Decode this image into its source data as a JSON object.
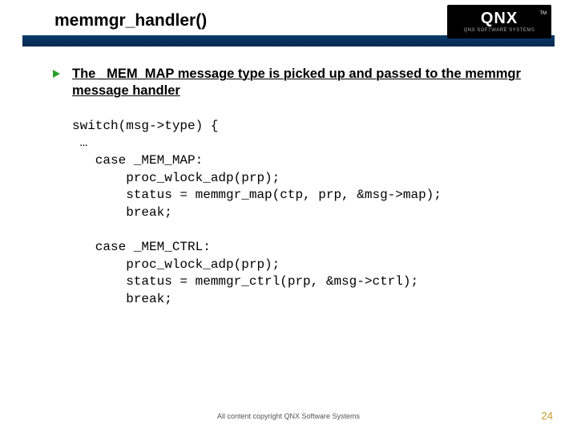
{
  "header": {
    "title": "memmgr_handler()",
    "logo_main": "QNX",
    "logo_sub": "QNX SOFTWARE SYSTEMS",
    "logo_tm": "TM"
  },
  "bullet": {
    "text": "The _MEM_MAP message type is picked up and passed to the memmgr message handler"
  },
  "code": {
    "text": "switch(msg->type) {\n …\n   case _MEM_MAP:\n       proc_wlock_adp(prp);\n       status = memmgr_map(ctp, prp, &msg->map);\n       break;\n\n   case _MEM_CTRL:\n       proc_wlock_adp(prp);\n       status = memmgr_ctrl(prp, &msg->ctrl);\n       break;"
  },
  "footer": {
    "copyright": "All content copyright QNX Software Systems",
    "page": "24"
  }
}
